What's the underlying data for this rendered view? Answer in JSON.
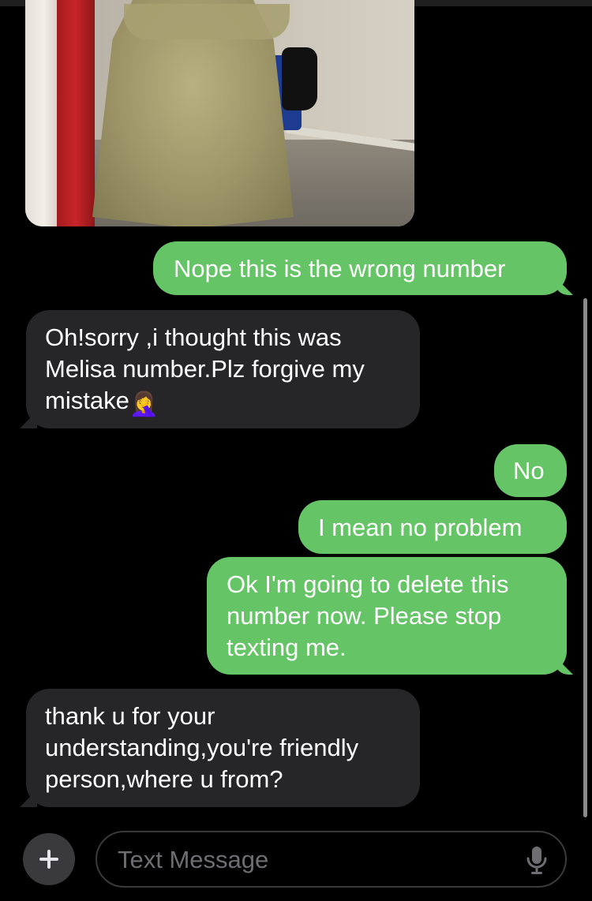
{
  "conversation": {
    "messages": [
      {
        "direction": "outgoing",
        "text": "Nope this is the wrong number"
      },
      {
        "direction": "incoming",
        "text": "Oh!sorry ,i thought this was Melisa number.Plz forgive my mistake",
        "emoji": "🤦‍♀️"
      },
      {
        "direction": "outgoing",
        "text": "No"
      },
      {
        "direction": "outgoing",
        "text": "I mean no problem"
      },
      {
        "direction": "outgoing",
        "text": "Ok I'm going to delete this number now. Please stop texting me."
      },
      {
        "direction": "incoming",
        "text": "thank u for your understanding,you're friendly person,where u from?"
      }
    ]
  },
  "composer": {
    "placeholder": "Text Message",
    "plus_icon": "plus-icon",
    "mic_icon": "microphone-icon"
  },
  "colors": {
    "outgoing_bubble": "#65c466",
    "incoming_bubble": "#262628",
    "background": "#000000"
  }
}
